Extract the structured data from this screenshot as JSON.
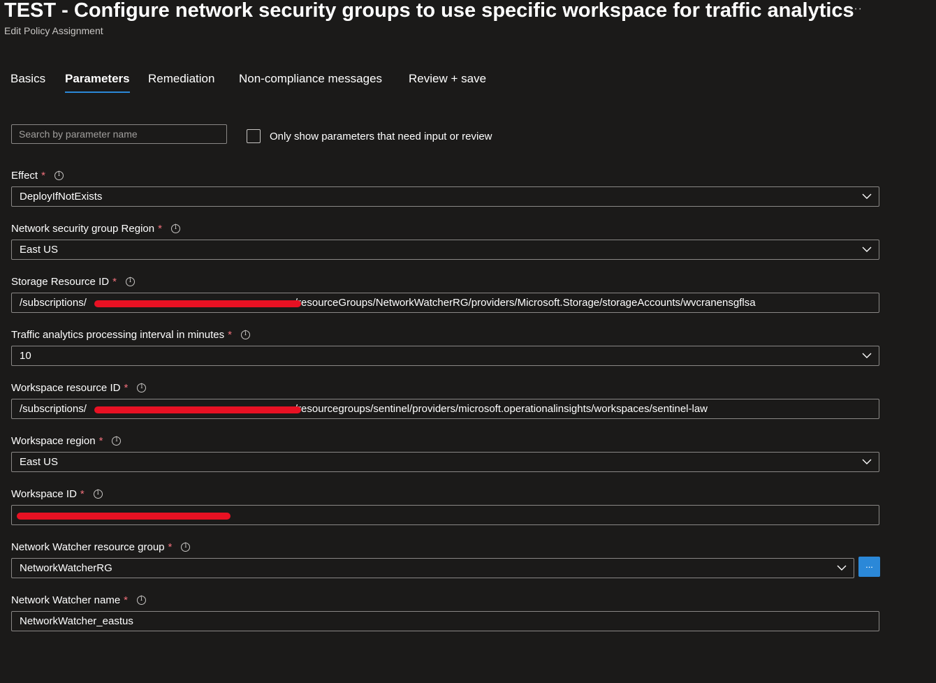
{
  "header": {
    "title": "TEST - Configure network security groups to use specific workspace for traffic analytics",
    "more_icon": "···",
    "subtitle": "Edit Policy Assignment"
  },
  "tabs": [
    {
      "label": "Basics",
      "active": false
    },
    {
      "label": "Parameters",
      "active": true
    },
    {
      "label": "Remediation",
      "active": false
    },
    {
      "label": "Non-compliance messages",
      "active": false
    },
    {
      "label": "Review + save",
      "active": false
    }
  ],
  "filter": {
    "search_placeholder": "Search by parameter name",
    "checkbox_label": "Only show parameters that need input or review",
    "checkbox_checked": false
  },
  "required_mark": "*",
  "fields": {
    "effect": {
      "label": "Effect",
      "value": "DeployIfNotExists",
      "type": "dropdown"
    },
    "nsg_region": {
      "label": "Network security group Region",
      "value": "East US",
      "type": "dropdown"
    },
    "storage_id": {
      "label": "Storage Resource ID",
      "value_prefix": "/subscriptions/",
      "value_suffix": "/resourceGroups/NetworkWatcherRG/providers/Microsoft.Storage/storageAccounts/wvcranensgflsa",
      "type": "text"
    },
    "interval": {
      "label": "Traffic analytics processing interval in minutes",
      "value": "10",
      "type": "dropdown"
    },
    "workspace_id_res": {
      "label": "Workspace resource ID",
      "value_prefix": "/subscriptions/",
      "value_suffix": "/resourcegroups/sentinel/providers/microsoft.operationalinsights/workspaces/sentinel-law",
      "type": "text"
    },
    "workspace_region": {
      "label": "Workspace region",
      "value": "East US",
      "type": "dropdown"
    },
    "workspace_id": {
      "label": "Workspace ID",
      "value": "",
      "type": "text"
    },
    "nw_rg": {
      "label": "Network Watcher resource group",
      "value": "NetworkWatcherRG",
      "type": "dropdown",
      "button_label": "..."
    },
    "nw_name": {
      "label": "Network Watcher name",
      "value": "NetworkWatcher_eastus",
      "type": "text"
    }
  },
  "colors": {
    "background": "#1b1a19",
    "accent": "#2b88d8",
    "required": "#f1707b",
    "redaction": "#e81123"
  }
}
